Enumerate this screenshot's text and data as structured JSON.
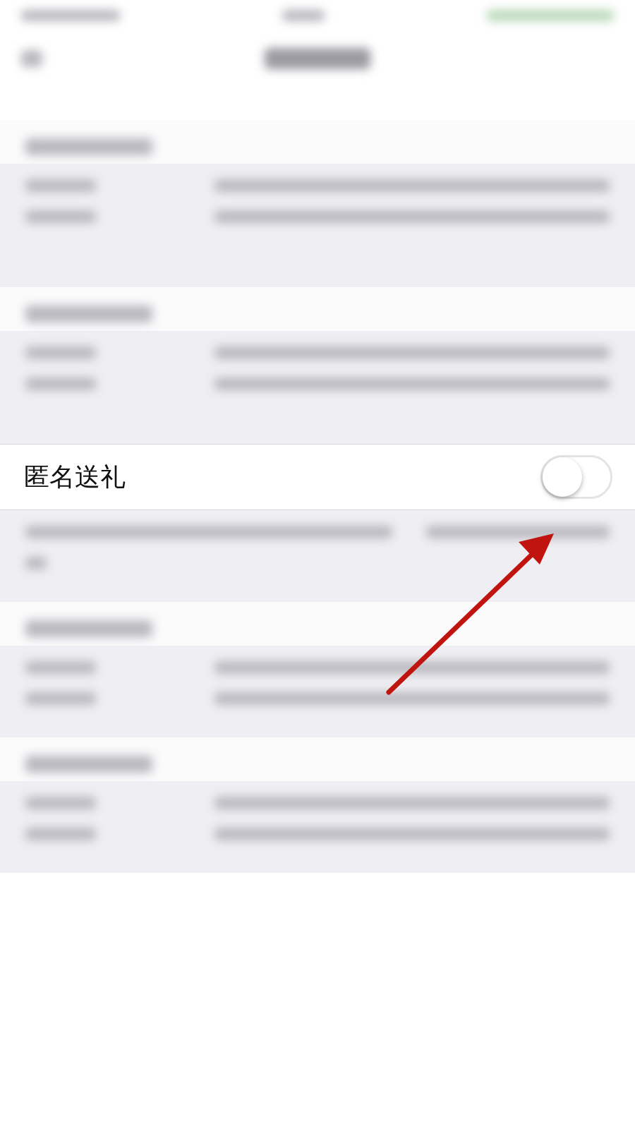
{
  "setting": {
    "label": "匿名送礼",
    "on": false
  }
}
